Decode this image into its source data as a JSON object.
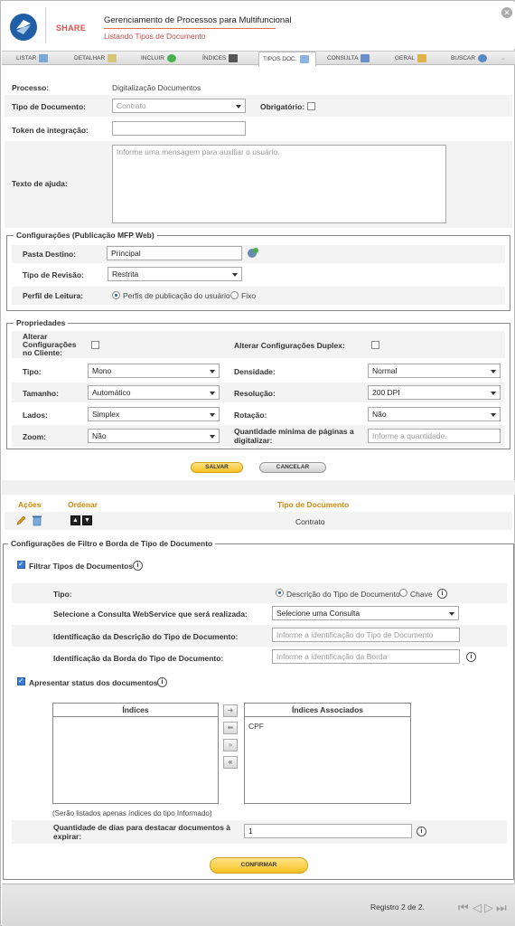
{
  "header": {
    "brand": "SHARE",
    "title": "Gerenciamento de Processos para Multifuncional",
    "subtitle": "Listando Tipos de Documento"
  },
  "tabs": [
    {
      "label": "LISTAR"
    },
    {
      "label": "DETALHAR"
    },
    {
      "label": "INCLUIR"
    },
    {
      "label": "ÍNDICES"
    },
    {
      "label": "TIPOS DOC."
    },
    {
      "label": "CONSULTA"
    },
    {
      "label": "GERAL"
    },
    {
      "label": "BUSCAR"
    }
  ],
  "form": {
    "processo_label": "Processo:",
    "processo_value": "Digitalização Documentos",
    "tipo_doc_label": "Tipo de Documento:",
    "tipo_doc_value": "Contrato",
    "obrigatorio_label": "Obrigatório:",
    "token_label": "Token de integração:",
    "token_value": "",
    "ajuda_label": "Texto de ajuda:",
    "ajuda_placeholder": "Informe uma mensagem para auxiliar o usuário."
  },
  "config_mfp": {
    "legend": "Configurações (Publicação MFP Web)",
    "pasta_label": "Pasta Destino:",
    "pasta_value": "Principal",
    "revisao_label": "Tipo de Revisão:",
    "revisao_value": "Restrita",
    "perfil_label": "Perfil de Leitura:",
    "perfil_opt1": "Perfis de publicação do usuário",
    "perfil_opt2": "Fixo"
  },
  "propriedades": {
    "legend": "Propriedades",
    "alterar_cliente_label": "Alterar Configurações no Cliente:",
    "alterar_duplex_label": "Alterar Configurações Duplex:",
    "tipo_label": "Tipo:",
    "tipo_value": "Mono",
    "densidade_label": "Densidade:",
    "densidade_value": "Normal",
    "tamanho_label": "Tamanho:",
    "tamanho_value": "Automático",
    "resolucao_label": "Resolução:",
    "resolucao_value": "200 DPI",
    "lados_label": "Lados:",
    "lados_value": "Simplex",
    "rotacao_label": "Rotação:",
    "rotacao_value": "Não",
    "zoom_label": "Zoom:",
    "zoom_value": "Não",
    "qtd_min_label": "Quantidade mínima de páginas a digitalizar:",
    "qtd_min_placeholder": "Informe a quantidade."
  },
  "buttons": {
    "salvar": "SALVAR",
    "cancelar": "CANCELAR",
    "confirmar": "CONFIRMAR"
  },
  "table": {
    "headers": [
      "Ações",
      "Ordenar",
      "Tipo de Documento"
    ],
    "rows": [
      {
        "tipo": "Contrato"
      }
    ]
  },
  "filtro": {
    "legend": "Configurações de Filtro e Borda de Tipo de Documento",
    "filtrar_label": "Filtrar Tipos de Documentos",
    "tipo_label": "Tipo:",
    "tipo_opt1": "Descrição do Tipo de Documento",
    "tipo_opt2": "Chave",
    "consulta_label": "Selecione a Consulta WebService que será realizada:",
    "consulta_value": "Selecione uma Consulta",
    "ident_desc_label": "Identificação da Descrição do Tipo de Documento:",
    "ident_desc_placeholder": "Informe a identificação do Tipo de Documento",
    "ident_borda_label": "Identificação da Borda do Tipo de Documento:",
    "ident_borda_placeholder": "Informe a identificação da Borda",
    "status_label": "Apresentar status dos documentos",
    "indices_header": "Índices",
    "indices_assoc_header": "Índices Associados",
    "indices_assoc_items": [
      "CPF"
    ],
    "note": "(Serão listados apenas índices do tipo Informado)",
    "dias_label": "Quantidade de dias para destacar documentos à expirar:",
    "dias_value": "1"
  },
  "footer": {
    "registro": "Registro 2 de 2."
  }
}
